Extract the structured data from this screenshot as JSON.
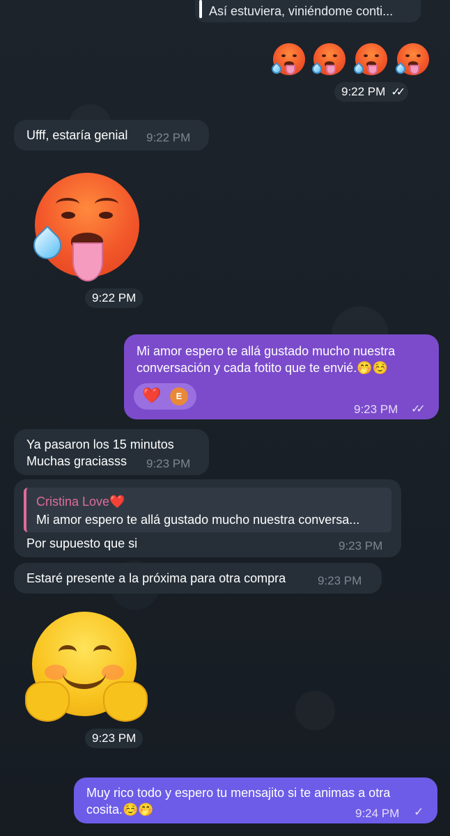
{
  "colors": {
    "incoming_bubble": "#262f38",
    "outgoing_bubble": "#7b4bcc",
    "reply_accent": "#e06b9a",
    "reply_name": "#e06b9a"
  },
  "messages": {
    "quoted_top": "Así estuviera, viniéndome conti...",
    "emoji_row_time": "9:22 PM",
    "msg1_text": "Ufff, estaría genial",
    "msg1_time": "9:22 PM",
    "sticker1_time": "9:22 PM",
    "msg2_text_line1": "Mi amor espero te allá gustado mucho nuestra",
    "msg2_text_line2": "conversación y cada fotito que te envié.🤭☺️",
    "msg2_reaction_heart": "❤️",
    "msg2_reaction_avatar": "E",
    "msg2_time": "9:23 PM",
    "msg3_line1": "Ya pasaron los 15 minutos",
    "msg3_line2": "Muchas graciasss",
    "msg3_time": "9:23 PM",
    "msg4_reply_name": "Cristina Love❤️",
    "msg4_reply_text": "Mi amor espero te allá gustado mucho nuestra conversa...",
    "msg4_text": "Por supuesto que si",
    "msg4_time": "9:23 PM",
    "msg5_text": "Estaré presente a la próxima para otra compra",
    "msg5_time": "9:23 PM",
    "sticker2_time": "9:23 PM",
    "msg6_line1": "Muy rico todo y espero tu mensajito si te animas a otra",
    "msg6_line2": "cosita.☺️🤭",
    "msg6_time": "9:24 PM"
  },
  "icons": {
    "double_check": "✓✓",
    "single_check": "✓"
  }
}
